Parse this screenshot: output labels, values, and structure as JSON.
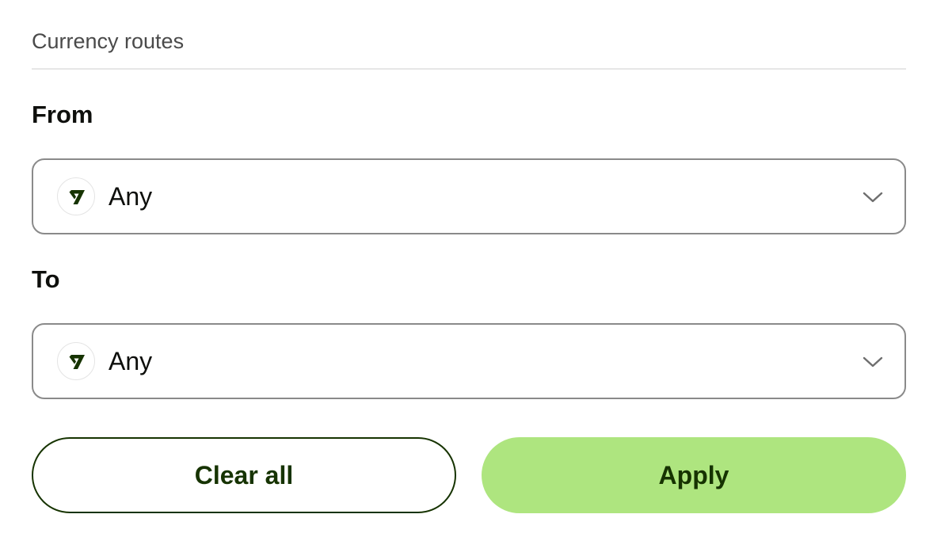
{
  "section": {
    "title": "Currency routes"
  },
  "from": {
    "label": "From",
    "value": "Any",
    "icon": "wise-logo-icon"
  },
  "to": {
    "label": "To",
    "value": "Any",
    "icon": "wise-logo-icon"
  },
  "buttons": {
    "clear_label": "Clear all",
    "apply_label": "Apply"
  },
  "colors": {
    "brand_dark_green": "#163300",
    "accent_light_green": "#aee57f",
    "border_gray": "#8a8a8a",
    "divider": "#e6e6e6"
  }
}
